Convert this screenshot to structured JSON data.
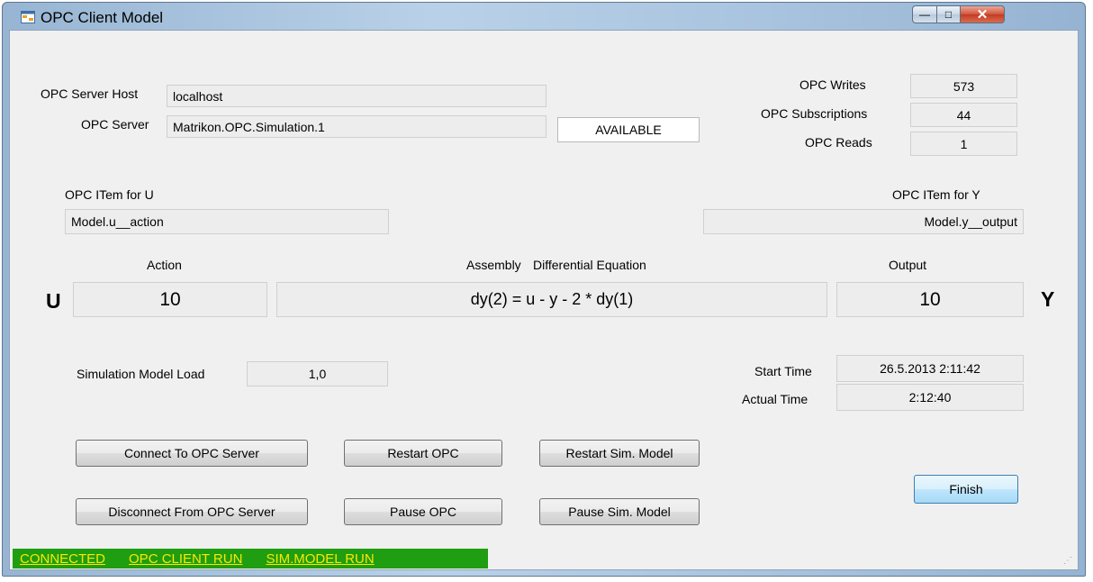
{
  "window": {
    "title": "OPC Client Model",
    "minimize_glyph": "—",
    "maximize_glyph": "□",
    "close_glyph": "✕",
    "icon": "app-window-icon"
  },
  "server": {
    "host_label": "OPC Server Host",
    "host_value": "localhost",
    "server_label": "OPC Server",
    "server_value": "Matrikon.OPC.Simulation.1",
    "availability": "AVAILABLE"
  },
  "counters": {
    "writes_label": "OPC Writes",
    "writes_value": "573",
    "subscriptions_label": "OPC Subscriptions",
    "subscriptions_value": "44",
    "reads_label": "OPC Reads",
    "reads_value": "1"
  },
  "items": {
    "u_label": "OPC ITem for U",
    "u_value": "Model.u__action",
    "y_label": "OPC ITem for Y",
    "y_value": "Model.y__output"
  },
  "model": {
    "action_label": "Action",
    "action_value": "10",
    "equation_label_1": "Assembly",
    "equation_label_2": "Differential Equation",
    "equation_value": "dy(2) = u - y - 2 * dy(1)",
    "output_label": "Output",
    "output_value": "10",
    "u_letter": "U",
    "y_letter": "Y"
  },
  "load": {
    "label": "Simulation Model Load",
    "value": "1,0"
  },
  "times": {
    "start_label": "Start Time",
    "start_value": "26.5.2013 2:11:42",
    "actual_label": "Actual Time",
    "actual_value": "2:12:40"
  },
  "buttons": {
    "connect": "Connect To OPC Server",
    "disconnect": "Disconnect From OPC Server",
    "restart_opc": "Restart OPC",
    "pause_opc": "Pause OPC",
    "restart_sim": "Restart Sim. Model",
    "pause_sim": "Pause Sim. Model",
    "finish": "Finish"
  },
  "status": {
    "connected": "CONNECTED",
    "client_run": "OPC CLIENT RUN",
    "model_run": "SIM.MODEL RUN",
    "background_color": "#1e9e10",
    "text_color": "#ffe600"
  }
}
